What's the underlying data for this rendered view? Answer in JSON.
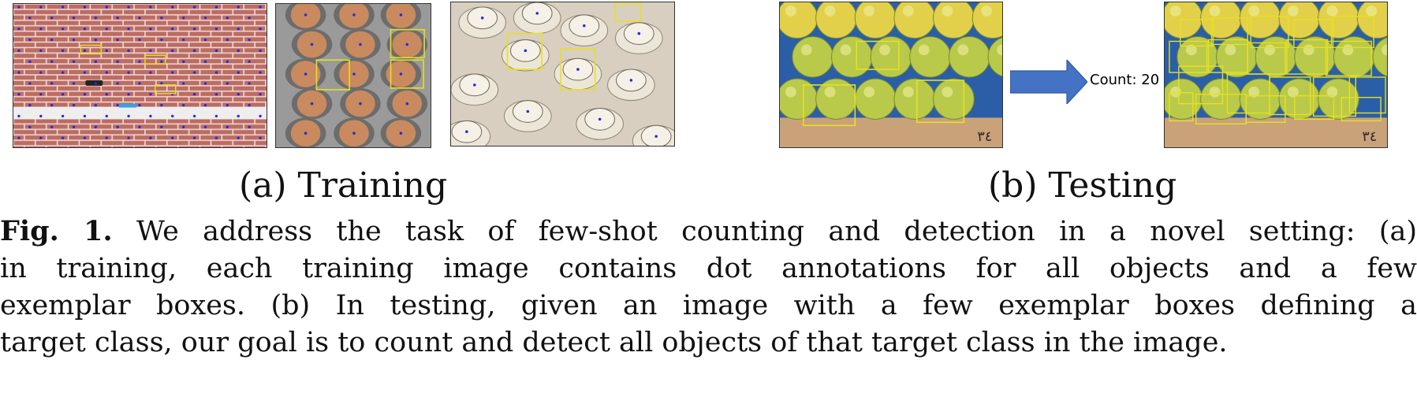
{
  "figure": {
    "testing_count_label": "Count: 20",
    "subcaption_a": "(a) Training",
    "subcaption_b": "(b) Testing",
    "caption_label": "Fig. 1.",
    "caption_lines": [
      " We address the task of few-shot counting and detection in a novel setting: (a)",
      "in training, each training image contains dot annotations for all objects and a few",
      "exemplar boxes. (b) In testing, given an image with a few exemplar boxes defining a",
      "target class, our goal is to count and detect all objects of that target class in the image."
    ]
  },
  "colors": {
    "dot": "#2a2ad8",
    "box": "#e8e020",
    "arrow": "#4472c4",
    "brick": "#b4584a",
    "mortar": "#e9dfe2"
  },
  "images": [
    {
      "name": "brick-wall-training-image"
    },
    {
      "name": "egg-carton-training-image"
    },
    {
      "name": "teacups-training-image"
    },
    {
      "name": "apples-testing-input-image"
    },
    {
      "name": "apples-testing-output-image"
    }
  ]
}
